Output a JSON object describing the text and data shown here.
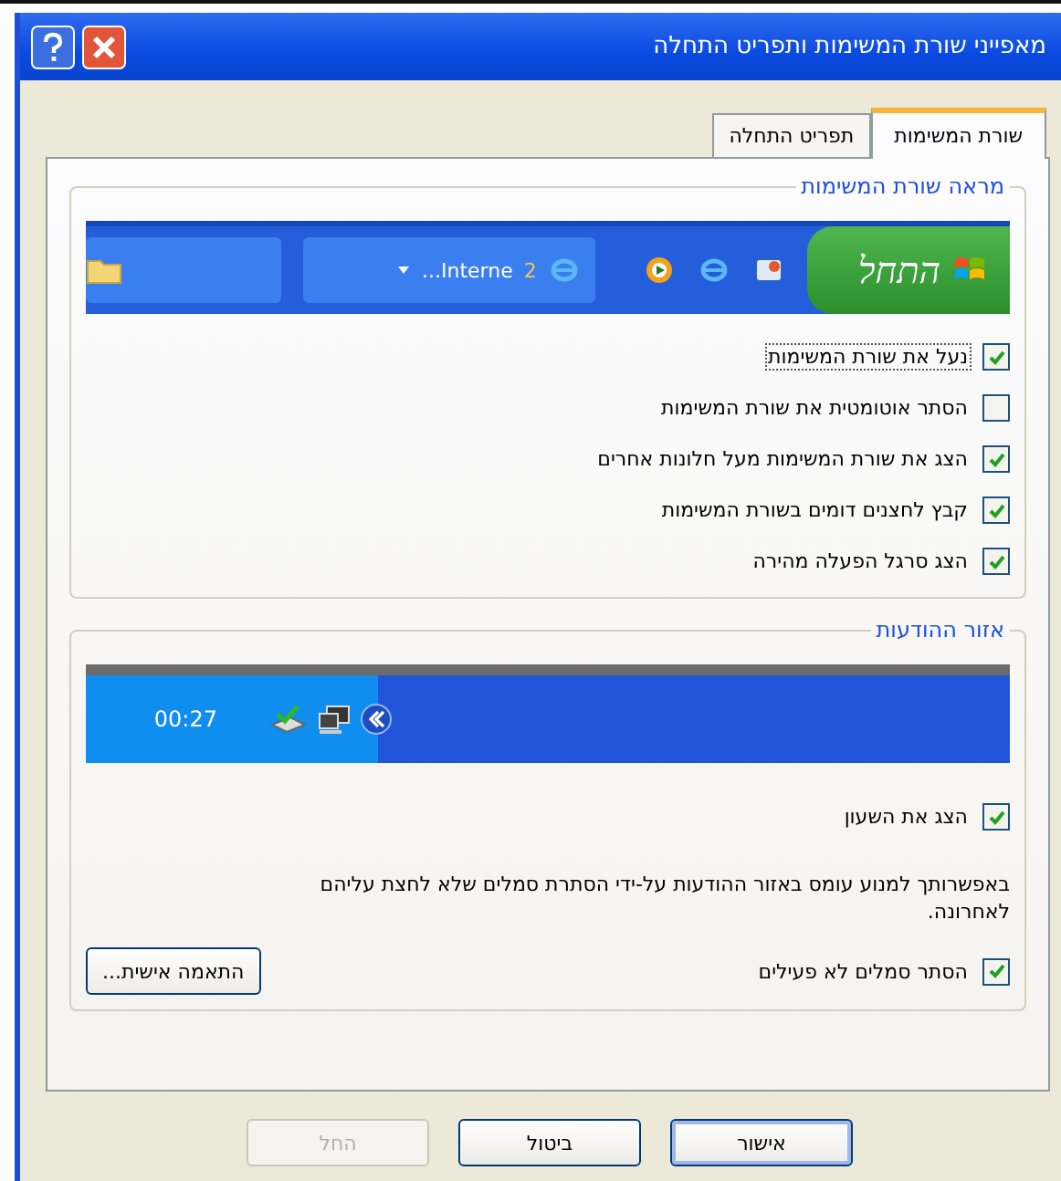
{
  "window": {
    "title": "מאפייני שורת המשימות ותפריט התחלה"
  },
  "tabs": [
    {
      "label": "שורת המשימות",
      "selected": true
    },
    {
      "label": "תפריט התחלה",
      "selected": false
    }
  ],
  "taskbar_group": {
    "title": "מראה שורת המשימות",
    "preview": {
      "start_label": "התחל",
      "task_count": "2",
      "task_label": "Interne..."
    },
    "options": [
      {
        "label": "נעל את שורת המשימות",
        "checked": true,
        "focused": true
      },
      {
        "label": "הסתר אוטומטית את שורת המשימות",
        "checked": false,
        "focused": false
      },
      {
        "label": "הצג את שורת המשימות מעל חלונות אחרים",
        "checked": true,
        "focused": false
      },
      {
        "label": "קבץ לחצנים דומים בשורת המשימות",
        "checked": true,
        "focused": false
      },
      {
        "label": "הצג סרגל הפעלה מהירה",
        "checked": true,
        "focused": false
      }
    ]
  },
  "notification_group": {
    "title": "אזור ההודעות",
    "preview": {
      "clock": "00:27"
    },
    "show_clock": {
      "label": "הצג את השעון",
      "checked": true
    },
    "description": "באפשרותך למנוע עומס באזור ההודעות על-ידי הסתרת סמלים שלא לחצת עליהם לאחרונה.",
    "hide_inactive": {
      "label": "הסתר סמלים לא פעילים",
      "checked": true
    },
    "customize_button": "התאמה אישית..."
  },
  "buttons": [
    {
      "label": "אישור",
      "disabled": false
    },
    {
      "label": "ביטול",
      "disabled": false
    },
    {
      "label": "החל",
      "disabled": true
    }
  ]
}
